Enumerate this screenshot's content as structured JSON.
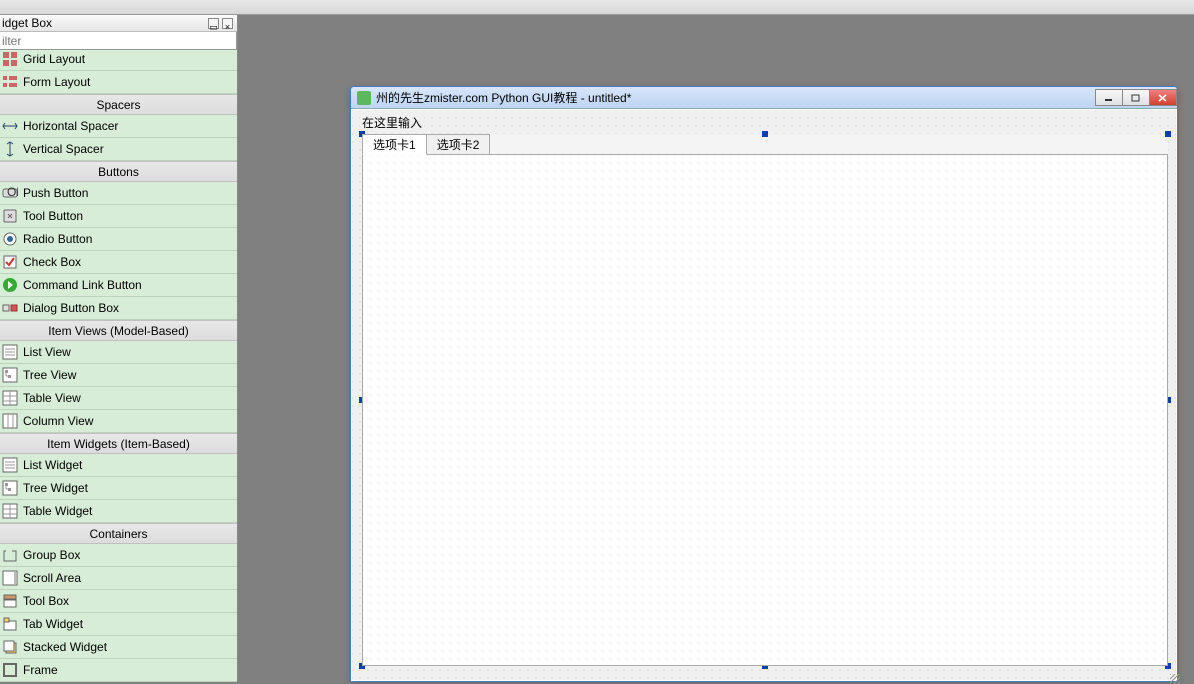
{
  "top_toolbar": {},
  "widget_box": {
    "title": "idget Box",
    "filter_placeholder": "ilter",
    "categories": [
      {
        "name": "",
        "items": [
          "Grid Layout",
          "Form Layout"
        ]
      },
      {
        "name": "Spacers",
        "items": [
          "Horizontal Spacer",
          "Vertical Spacer"
        ]
      },
      {
        "name": "Buttons",
        "items": [
          "Push Button",
          "Tool Button",
          "Radio Button",
          "Check Box",
          "Command Link Button",
          "Dialog Button Box"
        ]
      },
      {
        "name": "Item Views (Model-Based)",
        "items": [
          "List View",
          "Tree View",
          "Table View",
          "Column View"
        ]
      },
      {
        "name": "Item Widgets (Item-Based)",
        "items": [
          "List Widget",
          "Tree Widget",
          "Table Widget"
        ]
      },
      {
        "name": "Containers",
        "items": [
          "Group Box",
          "Scroll Area",
          "Tool Box",
          "Tab Widget",
          "Stacked Widget",
          "Frame"
        ]
      }
    ]
  },
  "design_window": {
    "title": "州的先生zmister.com Python GUI教程 - untitled*",
    "label_text": "在这里输入",
    "tabs": [
      "选项卡1",
      "选项卡2"
    ],
    "active_tab": 0
  }
}
